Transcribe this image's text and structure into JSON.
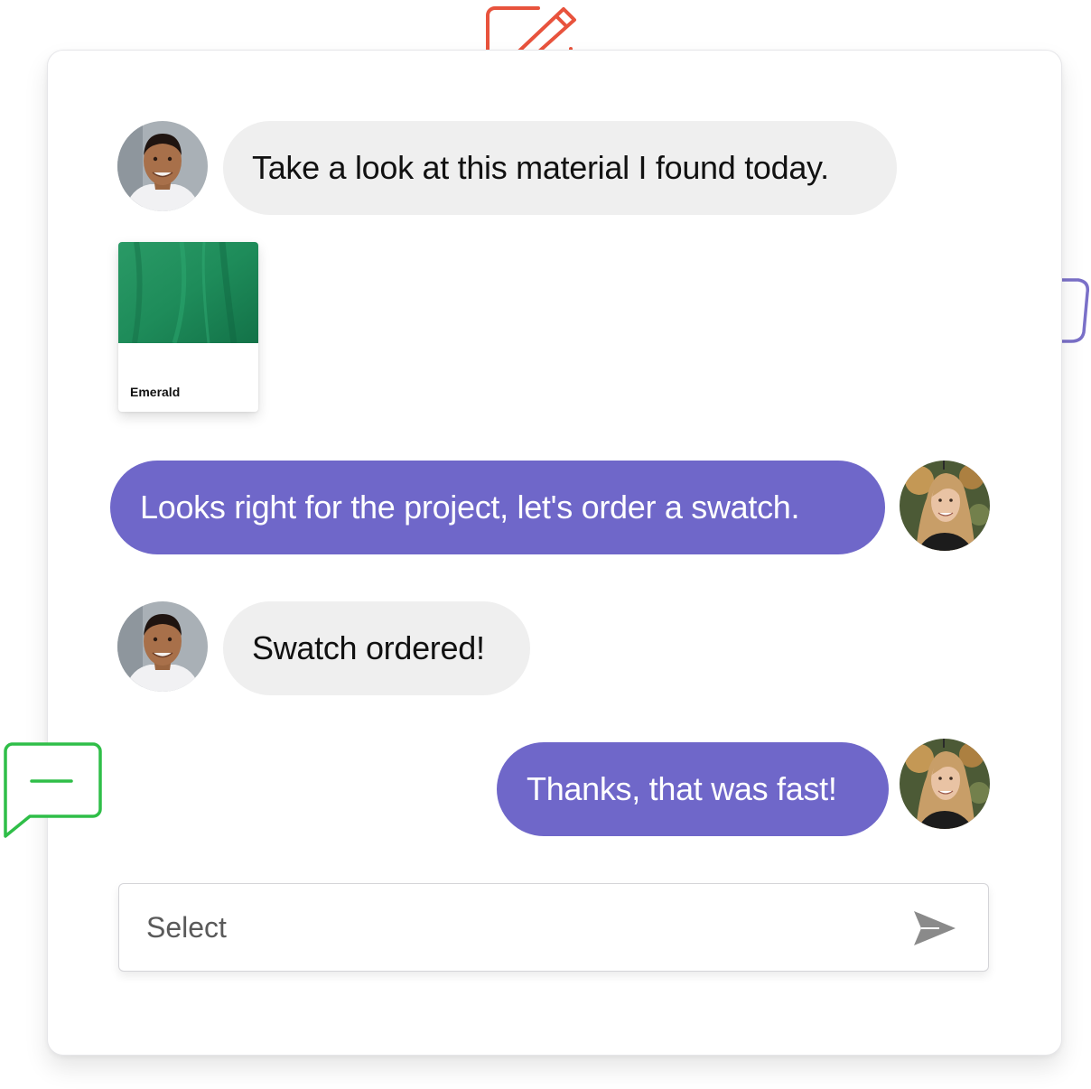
{
  "colors": {
    "outgoing_bubble": "#6f67c9",
    "incoming_bubble": "#efefef",
    "edit_icon": "#e8533d",
    "thumbs_icon": "#7a70c8",
    "comment_icon": "#2fbe48",
    "swatch_green": "#1f9460"
  },
  "icons": {
    "edit": "edit-icon",
    "like": "thumbs-up-icon",
    "comment": "comment-icon",
    "send": "send-icon"
  },
  "messages": [
    {
      "direction": "incoming",
      "text": "Take a look at this material I found today."
    },
    {
      "direction": "outgoing",
      "text": "Looks right for the project, let's order a swatch."
    },
    {
      "direction": "incoming",
      "text": "Swatch ordered!"
    },
    {
      "direction": "outgoing",
      "text": "Thanks, that was fast!"
    }
  ],
  "attachment": {
    "label": "Emerald"
  },
  "composer": {
    "placeholder": "Select"
  }
}
